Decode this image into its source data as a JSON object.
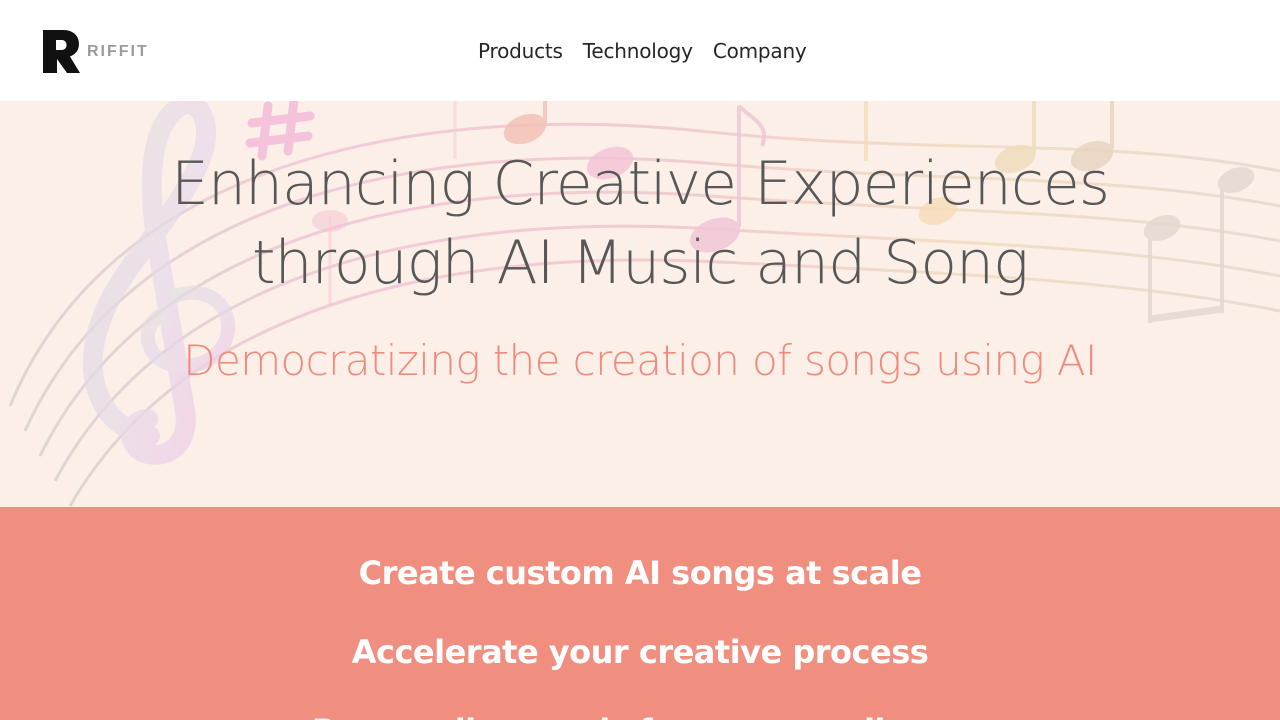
{
  "header": {
    "logo_text": "RIFFIT",
    "nav": [
      {
        "label": "Products"
      },
      {
        "label": "Technology"
      },
      {
        "label": "Company"
      }
    ]
  },
  "hero": {
    "title_line1": "Enhancing Creative Experiences",
    "title_line2": "through AI Music and Song",
    "subtitle": "Democratizing the creation of songs using AI",
    "background_icon": "music-staff-illustration"
  },
  "features": {
    "items": [
      {
        "text": "Create custom AI songs at scale"
      },
      {
        "text": "Accelerate your creative process"
      },
      {
        "text": "Personalize music for every audience"
      }
    ]
  },
  "colors": {
    "header_bg": "#ffffff",
    "hero_bg": "#fbefe7",
    "accent": "#f08f7f",
    "subtitle": "#ef8a7d",
    "title": "#575757",
    "nav_text": "#262626",
    "logo_gray": "#9b9b9b"
  }
}
